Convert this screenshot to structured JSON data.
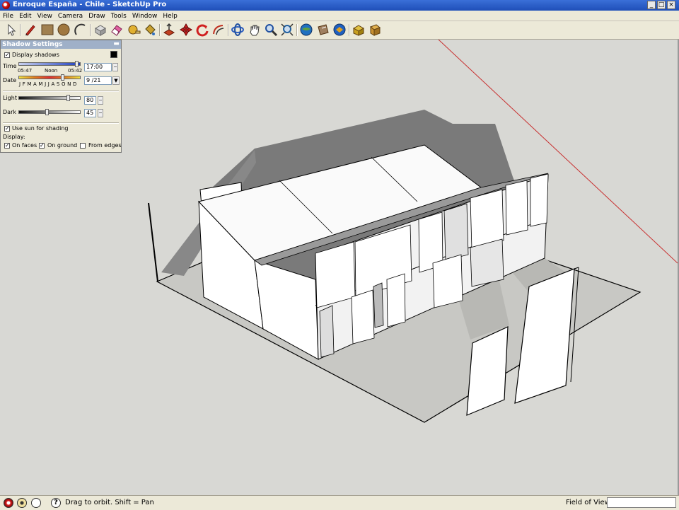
{
  "window": {
    "title": "Enroque España - Chile - SketchUp Pro",
    "controls": {
      "minimize": "_",
      "maximize": "□",
      "close": "×"
    }
  },
  "menu": [
    "File",
    "Edit",
    "View",
    "Camera",
    "Draw",
    "Tools",
    "Window",
    "Help"
  ],
  "toolbar": {
    "tools": [
      {
        "name": "select-icon",
        "color": "#555555"
      },
      {
        "name": "pencil-icon",
        "color": "#c83020"
      },
      {
        "name": "rectangle-icon",
        "color": "#a08050"
      },
      {
        "name": "circle-icon",
        "color": "#a07840"
      },
      {
        "name": "arc-icon",
        "color": "#333333"
      },
      {
        "name": "make-component-icon",
        "color": "#c0c0c0"
      },
      {
        "name": "eraser-icon",
        "color": "#d04070"
      },
      {
        "name": "tape-measure-icon",
        "color": "#d8a020"
      },
      {
        "name": "paint-bucket-icon",
        "color": "#c8a030"
      },
      {
        "name": "push-pull-icon",
        "color": "#c04020"
      },
      {
        "name": "move-icon",
        "color": "#c82020"
      },
      {
        "name": "rotate-icon",
        "color": "#d02020"
      },
      {
        "name": "offset-icon",
        "color": "#c03020"
      },
      {
        "name": "orbit-icon",
        "color": "#3060c0"
      },
      {
        "name": "pan-icon",
        "color": "#f0f0f0"
      },
      {
        "name": "zoom-icon",
        "color": "#2050a0"
      },
      {
        "name": "zoom-extents-icon",
        "color": "#2060a0"
      },
      {
        "name": "get-models-icon",
        "color": "#2070c0"
      },
      {
        "name": "share-model-icon",
        "color": "#806040"
      },
      {
        "name": "share-component-icon",
        "color": "#2060c0"
      },
      {
        "name": "extension-warehouse-icon",
        "color": "#c8a020"
      },
      {
        "name": "extension-manager-icon",
        "color": "#c89030"
      }
    ]
  },
  "shadow_panel": {
    "title": "Shadow Settings",
    "display_shadows": {
      "label": "Display shadows",
      "checked": true
    },
    "time": {
      "label": "Time",
      "start": "05:47",
      "noon": "Noon",
      "end": "05:42",
      "value": "17:00",
      "position": 0.93
    },
    "date": {
      "label": "Date",
      "months": "J F M A M J J A S O N D",
      "value": "9 /21",
      "position": 0.7
    },
    "light": {
      "label": "Light",
      "value": "80",
      "level": 0.8
    },
    "dark": {
      "label": "Dark",
      "value": "45",
      "level": 0.45
    },
    "use_sun": {
      "label": "Use sun for shading",
      "checked": true
    },
    "display_label": "Display:",
    "on_faces": {
      "label": "On faces",
      "checked": true
    },
    "on_ground": {
      "label": "On ground",
      "checked": true
    },
    "from_edges": {
      "label": "From edges",
      "checked": false
    }
  },
  "status": {
    "hint": "Drag to orbit.  Shift = Pan",
    "fov_label": "Field of View",
    "fov_value": ""
  },
  "colors": {
    "titlebar": "#2a5cc8",
    "viewport": "#d8d8d4",
    "shadow": "#7a7a7a",
    "face": "#ffffff",
    "axis_red": "#c83030"
  }
}
